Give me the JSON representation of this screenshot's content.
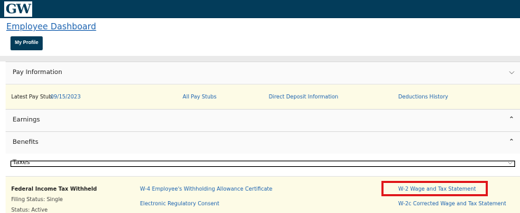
{
  "header": {
    "logo_text": "GW"
  },
  "dashboard": {
    "title": "Employee Dashboard",
    "profile_button": "My Profile"
  },
  "pay_information": {
    "title": "Pay Information",
    "latest_label": "Latest Pay Stub:",
    "latest_date": "09/15/2023",
    "links": [
      "All Pay Stubs",
      "Direct Deposit Information",
      "Deductions History"
    ]
  },
  "earnings": {
    "title": "Earnings"
  },
  "benefits": {
    "title": "Benefits"
  },
  "taxes": {
    "title": "Taxes",
    "federal_title": "Federal Income Tax Withheld",
    "filing_status": "Filing Status: Single",
    "status": "Status: Active",
    "links": [
      "W-4 Employee's Withholding Allowance Certificate",
      "Electronic Regulatory Consent",
      "W-2 Wage and Tax Statement",
      "W-2c Corrected Wage and Tax Statement"
    ]
  },
  "icons": {
    "pay_chevron": "chevron-down-icon",
    "earnings_chevron": "chevron-up-icon",
    "benefits_chevron": "chevron-up-icon",
    "taxes_chevron": "chevron-down-icon"
  },
  "colors": {
    "brand": "#033c5a",
    "link": "#1c63b0",
    "highlight": "#e0191d",
    "panel": "#fdfbe6"
  }
}
